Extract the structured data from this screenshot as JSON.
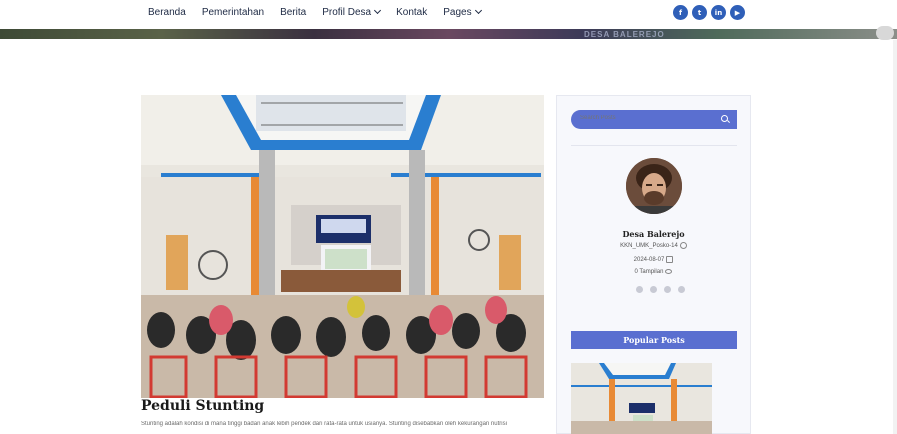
{
  "nav": {
    "items": [
      {
        "label": "Beranda",
        "dropdown": false
      },
      {
        "label": "Pemerintahan",
        "dropdown": false
      },
      {
        "label": "Berita",
        "dropdown": false
      },
      {
        "label": "Profil Desa",
        "dropdown": true
      },
      {
        "label": "Kontak",
        "dropdown": false
      },
      {
        "label": "Pages",
        "dropdown": true
      }
    ],
    "socials": [
      {
        "name": "facebook-icon",
        "glyph": "f"
      },
      {
        "name": "twitter-icon",
        "glyph": "t"
      },
      {
        "name": "linkedin-icon",
        "glyph": "in"
      },
      {
        "name": "youtube-icon",
        "glyph": "▶"
      }
    ]
  },
  "banner": {
    "text": "DESA BALEREJO"
  },
  "post": {
    "title": "Peduli Stunting",
    "excerpt": "Stunting adalah kondisi di mana tinggi badan anak lebih pendek dari rata-rata untuk usianya. Stunting disebabkan oleh kekurangan nutrisi"
  },
  "sidebar": {
    "search": {
      "placeholder": "Search Posts"
    },
    "author": {
      "name": "Desa Balerejo",
      "username": "KKN_UMK_Posko-14",
      "date": "2024-08-07",
      "views": "0 Tampilan"
    },
    "popular_header": "Popular Posts"
  },
  "colors": {
    "accent": "#5a6fd0",
    "social": "#2f5fb8",
    "text": "#1e2a44"
  }
}
